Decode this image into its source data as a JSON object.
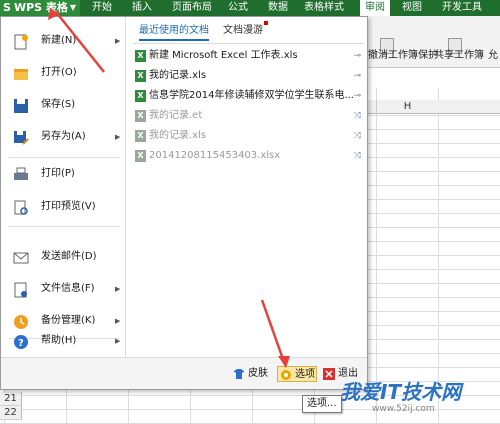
{
  "app": {
    "wps_button": "WPS 表格",
    "wps_letter": "S"
  },
  "tabs": [
    "开始",
    "插入",
    "页面布局",
    "公式",
    "数据",
    "表格样式",
    "审阅",
    "视图",
    "开发工具"
  ],
  "ribbon": {
    "items": [
      "撤消工作簿保护",
      "共享工作簿",
      "允"
    ]
  },
  "grid": {
    "col_h": "H",
    "rows": [
      "21",
      "22"
    ]
  },
  "menu": {
    "items": [
      {
        "label": "新建(N)",
        "icon": "new-icon",
        "arrow": "▶"
      },
      {
        "label": "打开(O)",
        "icon": "open-icon"
      },
      {
        "label": "保存(S)",
        "icon": "save-icon"
      },
      {
        "label": "另存为(A)",
        "icon": "save-as-icon",
        "arrow": "▶"
      },
      {
        "label": "打印(P)",
        "icon": "print-icon"
      },
      {
        "label": "打印预览(V)",
        "icon": "print-preview-icon"
      },
      {
        "label": "发送邮件(D)",
        "icon": "mail-icon"
      },
      {
        "label": "文件信息(F)",
        "icon": "file-info-icon",
        "arrow": "▶"
      },
      {
        "label": "备份管理(K)",
        "icon": "backup-icon",
        "arrow": "▶"
      },
      {
        "label": "帮助(H)",
        "icon": "help-icon",
        "arrow": "▶"
      }
    ],
    "right_tabs": {
      "recent": "最近使用的文档",
      "roaming": "文档漫游"
    },
    "recent_docs": [
      {
        "name": "新建 Microsoft Excel 工作表.xls",
        "pin": "⊸"
      },
      {
        "name": "我的记录.xls",
        "pin": "⊸"
      },
      {
        "name": "信息学院2014年修读辅修双学位学生联系电...",
        "pin": "⊸"
      },
      {
        "name": "我的记录.et",
        "pin": "⤨"
      },
      {
        "name": "我的记录.xls",
        "pin": "⤨"
      },
      {
        "name": "20141208115453403.xlsx",
        "pin": "⤨"
      }
    ],
    "bottom": {
      "skin": "皮肤",
      "options": "选项",
      "exit": "退出"
    }
  },
  "tooltip": "选项...",
  "watermark": {
    "text": "我爱IT技术网",
    "url": "www.52ij.com"
  },
  "colors": {
    "wps_green": "#2e8b3a",
    "accent": "#1a6eb5",
    "arrow_red": "#e8403a"
  }
}
